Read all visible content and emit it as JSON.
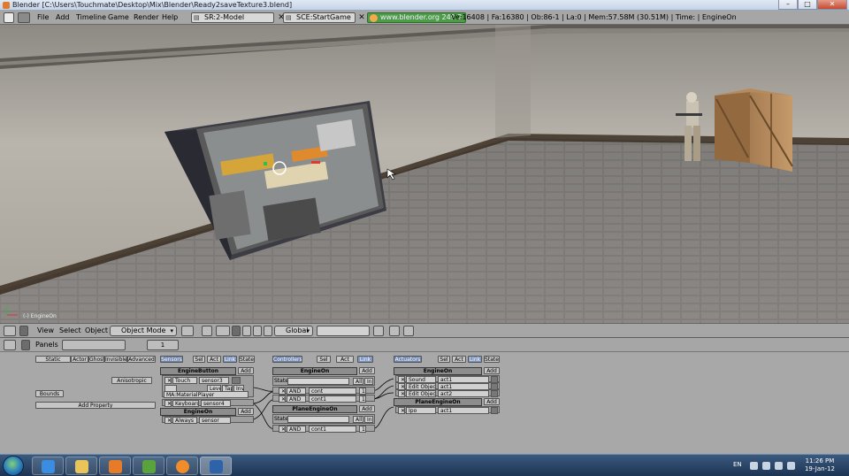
{
  "window": {
    "title": "Blender [C:\\Users\\Touchmate\\Desktop\\Mix\\Blender\\Ready2saveTexture3.blend]",
    "minimize_glyph": "–",
    "maximize_glyph": "□",
    "close_glyph": "✕"
  },
  "info_header": {
    "menus": [
      "File",
      "Add",
      "Timeline",
      "Game",
      "Render",
      "Help"
    ],
    "screen_field": {
      "prefix": "SR:",
      "value": "2-Model"
    },
    "scene_field": {
      "prefix": "SCE:",
      "value": "StartGame"
    },
    "url_badge": "www.blender.org 249.2",
    "stats": "Ve:16408 | Fa:16380 | Ob:86-1 | La:0 | Mem:57.58M (30.51M) | Time: | EngineOn"
  },
  "viewport": {
    "object_label": "(-) EngineOn"
  },
  "view_header": {
    "menus": [
      "View",
      "Select",
      "Object"
    ],
    "mode_select": "Object Mode",
    "orientation_select": "Global"
  },
  "buttons_header": {
    "panels_label": "Panels",
    "frame_value": "1"
  },
  "logic": {
    "object_tabs": [
      "Static",
      "Actor",
      "Ghost",
      "Invisible",
      "Advanced"
    ],
    "anisotropic_label": "Anisotropic",
    "bounds_label": "Bounds",
    "add_property_label": "Add Property",
    "sensors": {
      "header": "Sensors",
      "filters": [
        "Sel",
        "Act",
        "Link",
        "State"
      ],
      "groups": [
        {
          "object": "EngineButton",
          "add_label": "Add",
          "bricks": [
            {
              "type": "Touch",
              "name": "sensor3",
              "detail": "MA:MaterialPlayer",
              "extra": [
                "Level",
                "Tap",
                "Inv"
              ]
            },
            {
              "type": "Keyboard",
              "name": "sensor4"
            }
          ]
        },
        {
          "object": "EngineOn",
          "add_label": "Add",
          "bricks": [
            {
              "type": "Always",
              "name": "sensor"
            }
          ]
        }
      ]
    },
    "controllers": {
      "header": "Controllers",
      "filters": [
        "Sel",
        "Act",
        "Link"
      ],
      "groups": [
        {
          "object": "EngineOn",
          "add_label": "Add",
          "state_label": "State",
          "all_label": "All",
          "ini_label": "Ini",
          "bricks": [
            {
              "type": "AND",
              "name": "cont",
              "num": "1"
            },
            {
              "type": "AND",
              "name": "cont1",
              "num": "1"
            }
          ]
        },
        {
          "object": "PlaneEngineOn",
          "add_label": "Add",
          "state_label": "State",
          "all_label": "All",
          "ini_label": "Ini",
          "bricks": [
            {
              "type": "AND",
              "name": "cont1",
              "num": "1"
            }
          ]
        }
      ]
    },
    "actuators": {
      "header": "Actuators",
      "filters": [
        "Sel",
        "Act",
        "Link",
        "State"
      ],
      "groups": [
        {
          "object": "EngineOn",
          "add_label": "Add",
          "bricks": [
            {
              "type": "Sound",
              "name": "act1"
            },
            {
              "type": "Edit Object",
              "name": "act1"
            },
            {
              "type": "Edit Object",
              "name": "act2"
            }
          ]
        },
        {
          "object": "PlaneEngineOn",
          "add_label": "Add",
          "bricks": [
            {
              "type": "Ipo",
              "name": "act1"
            }
          ]
        }
      ]
    }
  },
  "taskbar": {
    "apps": [
      "windows-explorer",
      "internet-explorer",
      "file-folder",
      "media-player",
      "utorrent",
      "blender",
      "blender-player"
    ],
    "language": "EN",
    "clock_time": "11:26 PM",
    "clock_date": "19-Jan-12"
  },
  "colors": {
    "url_badge": "#4e9c48",
    "blender_panel": "#a6a6a6",
    "taskbar": "#1d3453"
  }
}
